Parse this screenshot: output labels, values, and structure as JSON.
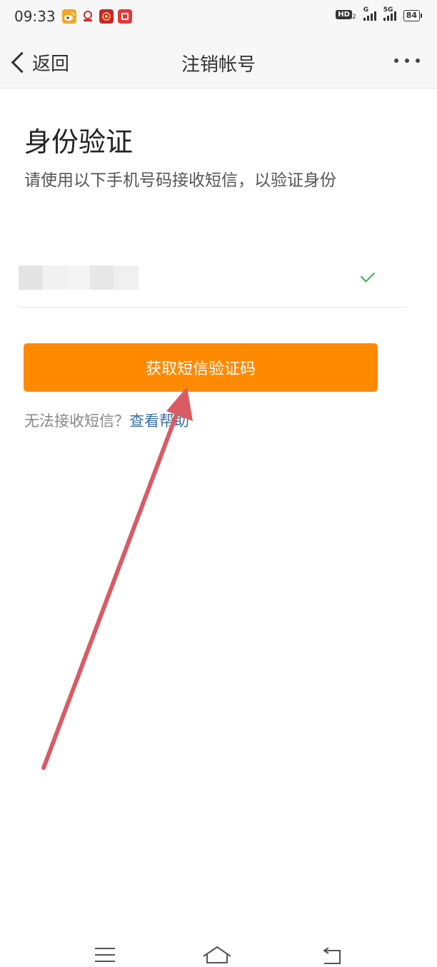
{
  "status_bar": {
    "time": "09:33",
    "hd": "HD",
    "hd_sub": "2",
    "net1": "G",
    "net2": "5G",
    "battery": "84"
  },
  "nav": {
    "back_label": "返回",
    "title": "注销帐号"
  },
  "content": {
    "title": "身份验证",
    "subtitle": "请使用以下手机号码接收短信，以验证身份",
    "sms_button_label": "获取短信验证码",
    "help_prompt": "无法接收短信？",
    "help_link": "查看帮助"
  },
  "colors": {
    "accent": "#ff8a00",
    "link": "#3a6fa8",
    "check": "#3fae5c",
    "annotation_arrow": "#d95b64"
  },
  "icons": {
    "back": "chevron-left-icon",
    "more": "more-dots-icon",
    "check": "check-icon",
    "menu": "menu-icon",
    "home": "home-icon",
    "return": "return-icon"
  }
}
